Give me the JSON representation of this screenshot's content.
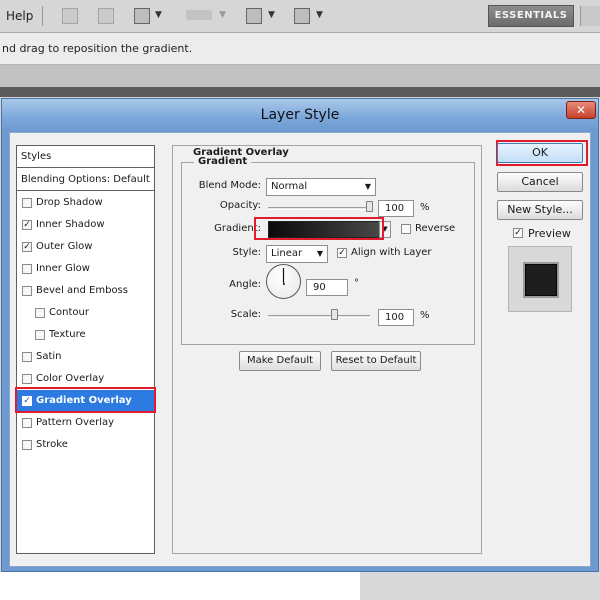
{
  "app": {
    "menu_help": "Help",
    "workspace_label": "ESSENTIALS",
    "options_hint": "nd drag to reposition the gradient."
  },
  "dialog": {
    "title": "Layer Style",
    "close_glyph": "✕"
  },
  "styles_list": {
    "header": "Styles",
    "blending_options": "Blending Options: Default",
    "items": [
      {
        "label": "Drop Shadow",
        "checked": false
      },
      {
        "label": "Inner Shadow",
        "checked": true
      },
      {
        "label": "Outer Glow",
        "checked": true
      },
      {
        "label": "Inner Glow",
        "checked": false
      },
      {
        "label": "Bevel and Emboss",
        "checked": false
      },
      {
        "label": "Contour",
        "checked": false
      },
      {
        "label": "Texture",
        "checked": false
      },
      {
        "label": "Satin",
        "checked": false
      },
      {
        "label": "Color Overlay",
        "checked": false
      },
      {
        "label": "Gradient Overlay",
        "checked": true,
        "selected": true
      },
      {
        "label": "Pattern Overlay",
        "checked": false
      },
      {
        "label": "Stroke",
        "checked": false
      }
    ]
  },
  "gradient_overlay": {
    "section_title": "Gradient Overlay",
    "group_title": "Gradient",
    "blend_mode_label": "Blend Mode:",
    "blend_mode_value": "Normal",
    "opacity_label": "Opacity:",
    "opacity_value": "100",
    "opacity_fraction": 1.0,
    "percent": "%",
    "gradient_label": "Gradient:",
    "reverse_label": "Reverse",
    "reverse_checked": false,
    "style_label": "Style:",
    "style_value": "Linear",
    "align_label": "Align with Layer",
    "align_checked": true,
    "angle_label": "Angle:",
    "angle_value": "90",
    "degree": "°",
    "scale_label": "Scale:",
    "scale_value": "100",
    "scale_fraction": 0.66,
    "make_default": "Make Default",
    "reset_default": "Reset to Default"
  },
  "actions": {
    "ok": "OK",
    "cancel": "Cancel",
    "new_style": "New Style...",
    "preview_label": "Preview",
    "preview_checked": true
  },
  "colors": {
    "accent_selection": "#2d7ae0",
    "highlight_box": "#e01d2f",
    "titlebar": "#7aa6d9"
  }
}
